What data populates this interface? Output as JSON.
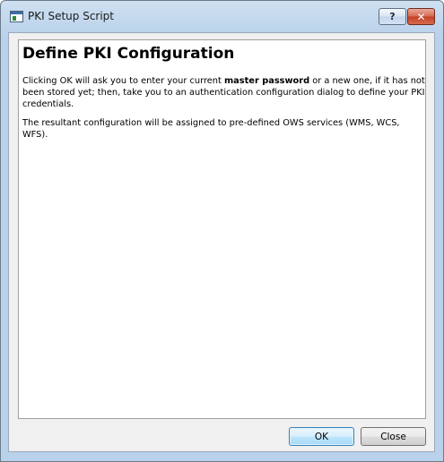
{
  "window": {
    "title": "PKI Setup Script",
    "help_label": "?",
    "close_label": "✕"
  },
  "content": {
    "heading": "Define PKI Configuration",
    "paragraph1_before": "Clicking OK will ask you to enter your current ",
    "paragraph1_bold": "master password",
    "paragraph1_after": " or a new one, if it has not been stored yet; then, take you to an authentication configuration dialog to define your PKI credentials.",
    "paragraph2": "The resultant configuration will be assigned to pre-defined OWS services (WMS, WCS, WFS)."
  },
  "buttons": {
    "ok_label": "OK",
    "close_label": "Close"
  },
  "icons": {
    "app": "window-app-icon",
    "help": "help-icon",
    "close": "close-icon"
  }
}
